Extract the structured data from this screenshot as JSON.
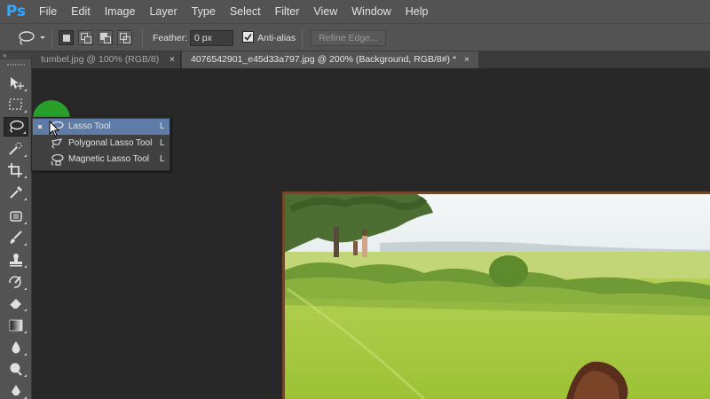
{
  "app": {
    "logo": "Ps"
  },
  "menu": [
    "File",
    "Edit",
    "Image",
    "Layer",
    "Type",
    "Select",
    "Filter",
    "View",
    "Window",
    "Help"
  ],
  "options": {
    "feather_label": "Feather:",
    "feather_value": "0 px",
    "antialias_label": "Anti-alias",
    "antialias_checked": true,
    "refine_edge": "Refine Edge..."
  },
  "tabs": [
    {
      "label": "tumbel.jpg @ 100% (RGB/8)",
      "close": "×",
      "active": false
    },
    {
      "label": "4076542901_e45d33a797.jpg @ 200% (Background, RGB/8#) *",
      "close": "×",
      "active": true
    }
  ],
  "toolpanel_header": "»",
  "flyout": [
    {
      "label": "Lasso Tool",
      "key": "L",
      "icon": "lasso-icon",
      "active": true
    },
    {
      "label": "Polygonal Lasso Tool",
      "key": "L",
      "icon": "polygonal-lasso-icon",
      "active": false
    },
    {
      "label": "Magnetic Lasso Tool",
      "key": "L",
      "icon": "magnetic-lasso-icon",
      "active": false
    }
  ],
  "colors": {
    "photoshop_blue": "#31a8ff",
    "highlight": "#5f7ca6",
    "cursor_highlight": "#27a52a"
  }
}
